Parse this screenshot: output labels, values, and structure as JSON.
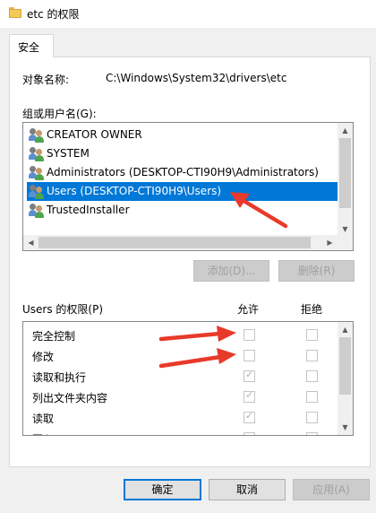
{
  "window": {
    "title": "etc 的权限",
    "icon": "folder-icon"
  },
  "tabs": [
    {
      "label": "安全",
      "active": true
    }
  ],
  "object": {
    "label": "对象名称:",
    "value": "C:\\Windows\\System32\\drivers\\etc"
  },
  "group_list": {
    "label": "组或用户名(G):",
    "items": [
      {
        "label": "CREATOR OWNER",
        "selected": false
      },
      {
        "label": "SYSTEM",
        "selected": false
      },
      {
        "label": "Administrators (DESKTOP-CTI90H9\\Administrators)",
        "selected": false
      },
      {
        "label": "Users (DESKTOP-CTI90H9\\Users)",
        "selected": true
      },
      {
        "label": "TrustedInstaller",
        "selected": false
      }
    ]
  },
  "buttons": {
    "add": "添加(D)...",
    "remove": "删除(R)",
    "ok": "确定",
    "cancel": "取消",
    "apply": "应用(A)"
  },
  "permissions": {
    "label": "Users 的权限(P)",
    "allow_header": "允许",
    "deny_header": "拒绝",
    "rows": [
      {
        "name": "完全控制",
        "allow": false,
        "deny": false
      },
      {
        "name": "修改",
        "allow": false,
        "deny": false
      },
      {
        "name": "读取和执行",
        "allow": true,
        "deny": false
      },
      {
        "name": "列出文件夹内容",
        "allow": true,
        "deny": false
      },
      {
        "name": "读取",
        "allow": true,
        "deny": false
      },
      {
        "name": "写入",
        "allow": false,
        "deny": false
      }
    ]
  },
  "annotations": {
    "arrow_color": "#e83a2a"
  },
  "colors": {
    "selection": "#0078d7",
    "default_button_border": "#0078d7"
  }
}
